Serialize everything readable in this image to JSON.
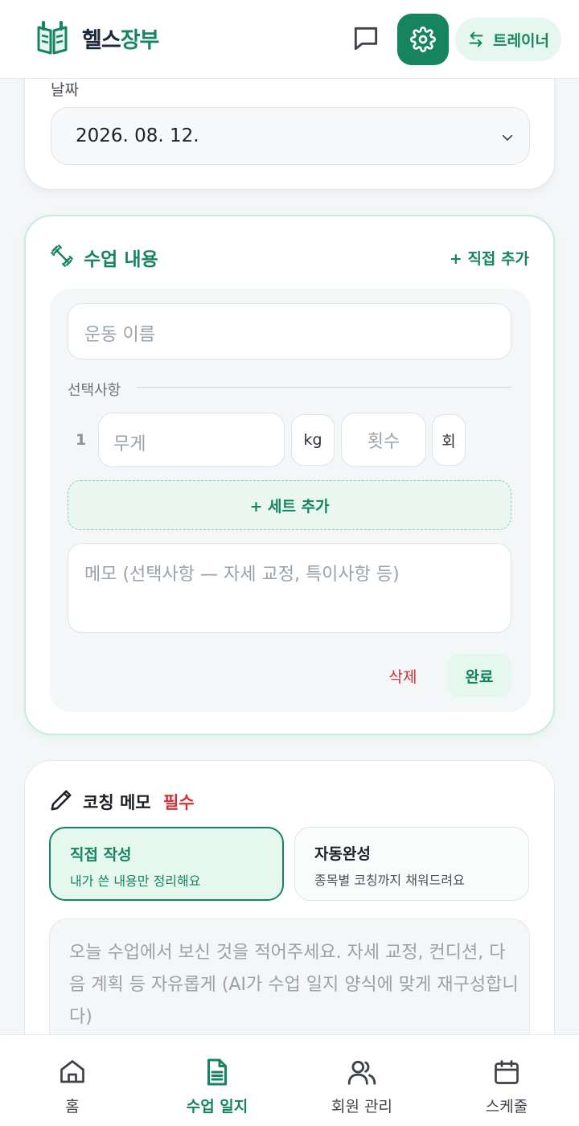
{
  "header": {
    "brand_part1": "헬스",
    "brand_part2": "장부",
    "logo_icon": "open-book-logo-icon",
    "trainer_label": "트레이너",
    "colors": {
      "accent": "#16855f",
      "accent_light": "#e6f7ef"
    }
  },
  "date_card": {
    "label": "날짜",
    "value": "2026. 08. 12."
  },
  "class_card": {
    "title": "수업 내용",
    "add_direct": "+ 직접 추가",
    "exercise_placeholder": "운동 이름",
    "optional_label": "선택사항",
    "set_number": "1",
    "weight_placeholder": "무게",
    "weight_unit": "kg",
    "reps_placeholder": "횟수",
    "reps_unit": "회",
    "add_set": "+ 세트 추가",
    "memo_placeholder": "메모 (선택사항 — 자세 교정, 특이사항 등)",
    "delete": "삭제",
    "done": "완료"
  },
  "coaching_card": {
    "title": "코칭 메모",
    "required": "필수",
    "mode_direct_title": "직접 작성",
    "mode_direct_sub": "내가 쓴 내용만 정리해요",
    "mode_auto_title": "자동완성",
    "mode_auto_sub": "종목별 코칭까지 채워드려요",
    "selected_mode": "직접 작성",
    "placeholder": "오늘 수업에서 보신 것을 적어주세요. 자세 교정, 컨디션, 다음 계획 등 자유롭게 (AI가 수업 일지 양식에 맞게 재구성합니다)"
  },
  "nav": {
    "items": [
      {
        "label": "홈",
        "icon": "home-icon"
      },
      {
        "label": "수업 일지",
        "icon": "document-icon"
      },
      {
        "label": "회원 관리",
        "icon": "users-icon"
      },
      {
        "label": "스케줄",
        "icon": "calendar-icon"
      }
    ],
    "active": "수업 일지"
  }
}
